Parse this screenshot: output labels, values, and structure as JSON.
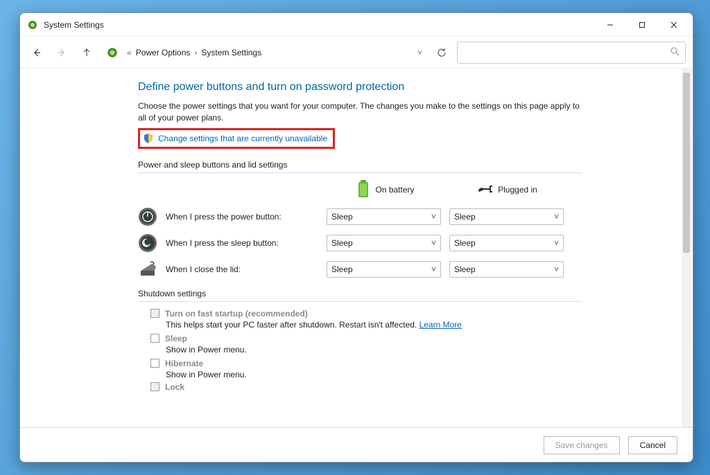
{
  "window": {
    "title": "System Settings"
  },
  "breadcrumb": {
    "segment1": "Power Options",
    "segment2": "System Settings"
  },
  "main": {
    "heading": "Define power buttons and turn on password protection",
    "subtext": "Choose the power settings that you want for your computer. The changes you make to the settings on this page apply to all of your power plans.",
    "change_link": "Change settings that are currently unavailable",
    "section1_label": "Power and sleep buttons and lid settings",
    "col_battery": "On battery",
    "col_plugged": "Plugged in",
    "rows": [
      {
        "label": "When I press the power button:",
        "battery": "Sleep",
        "plugged": "Sleep"
      },
      {
        "label": "When I press the sleep button:",
        "battery": "Sleep",
        "plugged": "Sleep"
      },
      {
        "label": "When I close the lid:",
        "battery": "Sleep",
        "plugged": "Sleep"
      }
    ],
    "section2_label": "Shutdown settings",
    "shutdown": {
      "fast_title": "Turn on fast startup (recommended)",
      "fast_desc": "This helps start your PC faster after shutdown. Restart isn't affected.",
      "learn_more": "Learn More",
      "sleep_title": "Sleep",
      "sleep_desc": "Show in Power menu.",
      "hibernate_title": "Hibernate",
      "hibernate_desc": "Show in Power menu.",
      "lock_title": "Lock"
    },
    "actions": {
      "save": "Save changes",
      "cancel": "Cancel"
    }
  }
}
